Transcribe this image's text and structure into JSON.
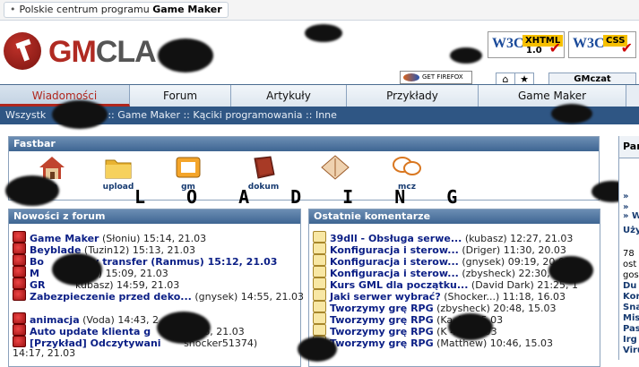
{
  "topbar": {
    "tagline_prefix": "Polskie centrum programu",
    "tagline_bold": "Game Maker"
  },
  "logo": {
    "gm": "GM",
    "rest": "CLA"
  },
  "badges": {
    "xhtml_label": "XHTML",
    "xhtml_version": "1.0",
    "css_label": "CSS",
    "w3c": "W3C",
    "firefox": "GET FIREFOX"
  },
  "chat_tab": "GMczat",
  "nav": {
    "tabs": [
      {
        "label": "Wiadomości",
        "active": true
      },
      {
        "label": "Forum"
      },
      {
        "label": "Artykuły"
      },
      {
        "label": "Przykłady"
      },
      {
        "label": "Game Maker"
      }
    ]
  },
  "breadcrumb": {
    "first": "Wszystk",
    "rest": ":: Game Maker :: Kąciki programowania :: Inne"
  },
  "fastbar": {
    "title": "Fastbar",
    "items": [
      {
        "label": "na",
        "icon": "home-icon"
      },
      {
        "label": "upload",
        "icon": "folder-icon"
      },
      {
        "label": "gm",
        "icon": "gm-icon"
      },
      {
        "label": "dokum",
        "icon": "book-icon"
      },
      {
        "label": "",
        "icon": "compass-icon"
      },
      {
        "label": "mcz",
        "icon": "chat-icon"
      }
    ],
    "loading_text": "LOADING"
  },
  "forum_news": {
    "title": "Nowości z forum",
    "items": [
      {
        "title": "Game Maker",
        "meta": "(Słoniu) 15:14, 21.03"
      },
      {
        "title": "Beyblade",
        "meta": "(Tuzin12) 15:13, 21.03"
      },
      {
        "title": "Bo",
        "meta": "czny transfer (Ranmus) 15:12, 21.03"
      },
      {
        "title": "M",
        "meta": "dzix) 15:09, 21.03"
      },
      {
        "title": "GR",
        "meta": "kubasz) 14:59, 21.03"
      },
      {
        "title": "Zabezpieczenie przed deko...",
        "meta": "(gnysek) 14:55, 21.03"
      },
      {
        "title": "animacja",
        "meta": "(Voda) 14:43, 2"
      },
      {
        "title": "Auto update klienta g",
        "meta": "4:36, 21.03"
      },
      {
        "title": "[Przykład] Odczytywani",
        "meta": "shocker51374)"
      },
      {
        "title": "",
        "meta": "14:17, 21.03"
      }
    ]
  },
  "comments": {
    "title": "Ostatnie komentarze",
    "items": [
      {
        "title": "39dll - Obsługa serwe...",
        "meta": "(kubasz) 12:27, 21.03"
      },
      {
        "title": "Konfiguracja i sterow...",
        "meta": "(Driger) 11:30, 20.03"
      },
      {
        "title": "Konfiguracja i sterow...",
        "meta": "(gnysek) 09:19, 20.03"
      },
      {
        "title": "Konfiguracja i sterow...",
        "meta": "(zbysheck) 22:30, 1"
      },
      {
        "title": "Kurs GML dla początku...",
        "meta": "(David Dark) 21:25, 1"
      },
      {
        "title": "Jaki serwer wybrać?",
        "meta": "(Shocker...) 11:18, 16.03"
      },
      {
        "title": "Tworzymy grę RPG",
        "meta": "(zbysheck) 20:48, 15.03"
      },
      {
        "title": "Tworzymy grę RPG",
        "meta": "(Ka 43, 15.03"
      },
      {
        "title": "Tworzymy grę RPG",
        "meta": "(K 41, 15.03"
      },
      {
        "title": "Tworzymy grę RPG",
        "meta": "(Matthew) 10:46, 15.03"
      }
    ]
  },
  "right": {
    "header": "Par",
    "lines": [
      "»",
      "»",
      "» W",
      "Uży",
      "78",
      "ost",
      "gos",
      "Du",
      "Kor",
      "Sna",
      "Mis",
      "Pas",
      "Irg",
      "Viru"
    ]
  }
}
